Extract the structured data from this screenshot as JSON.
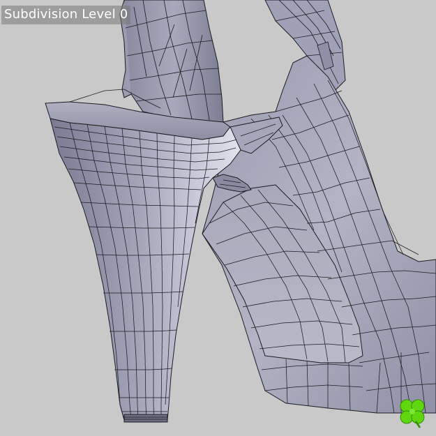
{
  "viewport": {
    "overlay_label": "Subdivision Level 0",
    "subject": "high-heel-shoe-wireframe-mesh"
  },
  "colors": {
    "background": "#c9c9c9",
    "mesh_surface": "#8e8ea6",
    "mesh_highlight": "#c5c5d6",
    "wire": "#1b1b22",
    "logo": "#5fd60e"
  },
  "icons": {
    "corner_logo": "clover-logo-icon"
  }
}
